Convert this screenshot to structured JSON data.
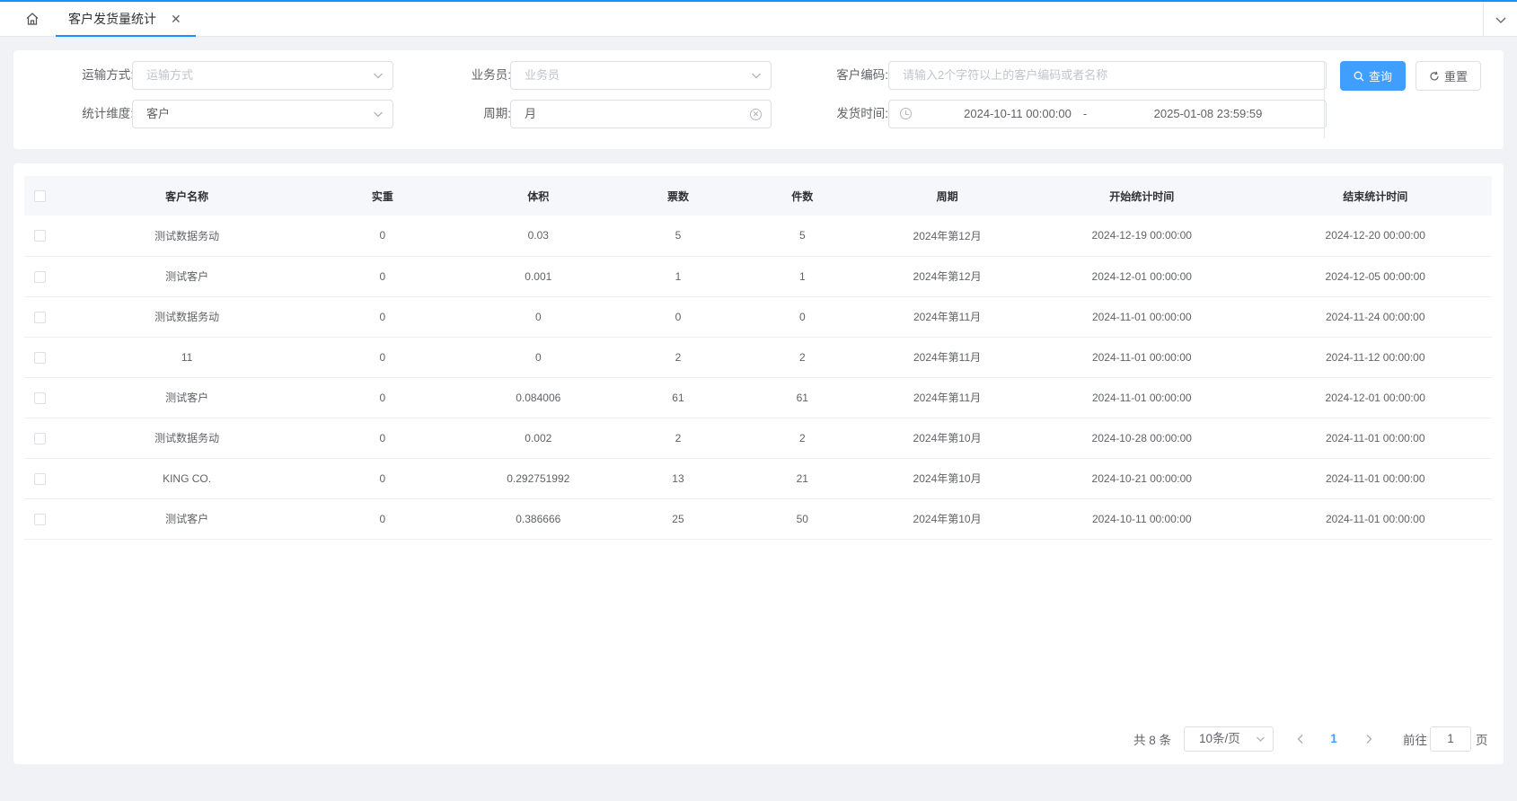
{
  "tabs": {
    "home_icon": "home-icon",
    "active_tab": "客户发货量统计",
    "close_icon": "close-icon",
    "more_icon": "chevron-down-icon"
  },
  "search": {
    "transport": {
      "label": "运输方式:",
      "placeholder": "运输方式"
    },
    "salesman": {
      "label": "业务员:",
      "placeholder": "业务员"
    },
    "customer_code": {
      "label": "客户编码:",
      "placeholder": "请输入2个字符以上的客户编码或者名称"
    },
    "dimension": {
      "label": "统计维度:",
      "value": "客户"
    },
    "period": {
      "label": "周期:",
      "value": "月"
    },
    "ship_time": {
      "label": "发货时间:",
      "start": "2024-10-11 00:00:00",
      "separator": "-",
      "end": "2025-01-08 23:59:59"
    },
    "query_button": "查询",
    "reset_button": "重置"
  },
  "table": {
    "columns": [
      "客户名称",
      "实重",
      "体积",
      "票数",
      "件数",
      "周期",
      "开始统计时间",
      "结束统计时间"
    ],
    "rows": [
      [
        "测试数据务动",
        "0",
        "0.03",
        "5",
        "5",
        "2024年第12月",
        "2024-12-19 00:00:00",
        "2024-12-20 00:00:00"
      ],
      [
        "测试客户",
        "0",
        "0.001",
        "1",
        "1",
        "2024年第12月",
        "2024-12-01 00:00:00",
        "2024-12-05 00:00:00"
      ],
      [
        "测试数据务动",
        "0",
        "0",
        "0",
        "0",
        "2024年第11月",
        "2024-11-01 00:00:00",
        "2024-11-24 00:00:00"
      ],
      [
        "11",
        "0",
        "0",
        "2",
        "2",
        "2024年第11月",
        "2024-11-01 00:00:00",
        "2024-11-12 00:00:00"
      ],
      [
        "测试客户",
        "0",
        "0.084006",
        "61",
        "61",
        "2024年第11月",
        "2024-11-01 00:00:00",
        "2024-12-01 00:00:00"
      ],
      [
        "测试数据务动",
        "0",
        "0.002",
        "2",
        "2",
        "2024年第10月",
        "2024-10-28 00:00:00",
        "2024-11-01 00:00:00"
      ],
      [
        "KING CO.",
        "0",
        "0.292751992",
        "13",
        "21",
        "2024年第10月",
        "2024-10-21 00:00:00",
        "2024-11-01 00:00:00"
      ],
      [
        "测试客户",
        "0",
        "0.386666",
        "25",
        "50",
        "2024年第10月",
        "2024-10-11 00:00:00",
        "2024-11-01 00:00:00"
      ]
    ]
  },
  "pagination": {
    "total": "共 8 条",
    "page_size": "10条/页",
    "current_page": "1",
    "goto_prefix": "前往",
    "goto_value": "1",
    "goto_suffix": "页"
  },
  "colors": {
    "accent": "#409eff",
    "tab_accent": "#1890ff"
  }
}
